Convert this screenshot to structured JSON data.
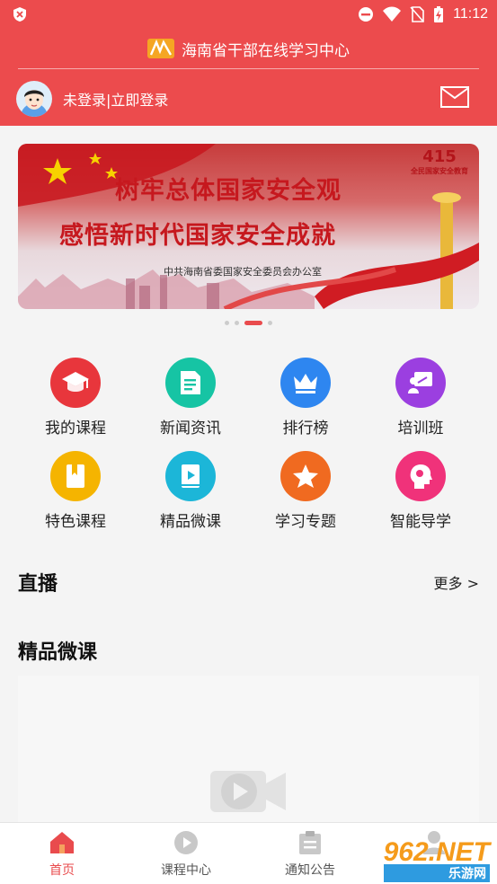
{
  "status_bar": {
    "time": "11:12"
  },
  "header": {
    "app_title": "海南省干部在线学习中心",
    "login_text": "未登录|立即登录"
  },
  "banner": {
    "line1": "树牢总体国家安全观",
    "line2": "感悟新时代国家安全成就",
    "line3": "中共海南省委国家安全委员会办公室",
    "tag_top": "415",
    "tag_bottom": "全民国家安全教育"
  },
  "carousel": {
    "count": 4,
    "active_index": 2
  },
  "menu": [
    {
      "label": "我的课程",
      "icon": "graduation-cap-icon",
      "color": "#e8363c"
    },
    {
      "label": "新闻资讯",
      "icon": "document-icon",
      "color": "#16c4a4"
    },
    {
      "label": "排行榜",
      "icon": "crown-icon",
      "color": "#2e86f0"
    },
    {
      "label": "培训班",
      "icon": "classroom-icon",
      "color": "#9b3fe0"
    },
    {
      "label": "特色课程",
      "icon": "bookmark-book-icon",
      "color": "#f5b400"
    },
    {
      "label": "精品微课",
      "icon": "play-book-icon",
      "color": "#1cb6d8"
    },
    {
      "label": "学习专题",
      "icon": "star-icon",
      "color": "#f06a20"
    },
    {
      "label": "智能导学",
      "icon": "brain-head-icon",
      "color": "#f0327a"
    }
  ],
  "sections": {
    "live_title": "直播",
    "more_label": "更多 >",
    "micro_title": "精品微课"
  },
  "tabbar": [
    {
      "label": "首页",
      "icon": "home-icon",
      "active": true
    },
    {
      "label": "课程中心",
      "icon": "play-circle-icon",
      "active": false
    },
    {
      "label": "通知公告",
      "icon": "clipboard-icon",
      "active": false
    },
    {
      "label": "",
      "icon": "user-icon",
      "active": false
    }
  ],
  "watermark": {
    "text": "962.NET",
    "sub": "乐游网"
  },
  "colors": {
    "brand_red": "#ec4b4d",
    "background": "#f4f4f4"
  }
}
